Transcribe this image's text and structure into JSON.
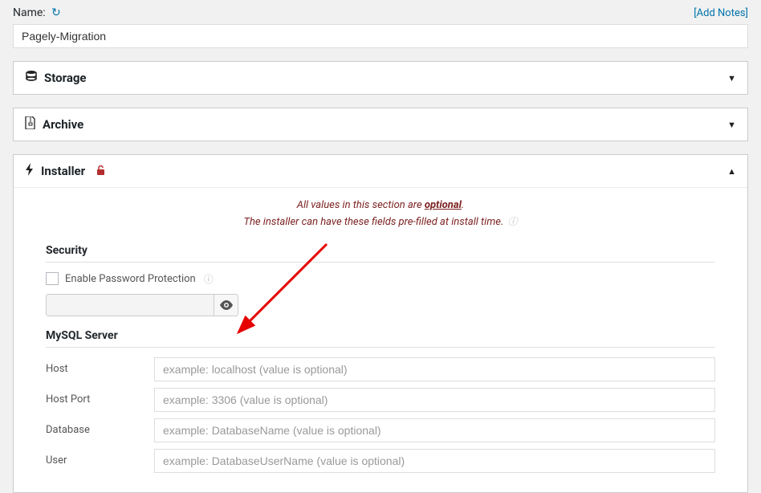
{
  "name_section": {
    "label": "Name:",
    "value": "Pagely-Migration",
    "add_notes": "[Add Notes]"
  },
  "panels": {
    "storage": {
      "title": "Storage"
    },
    "archive": {
      "title": "Archive"
    },
    "installer": {
      "title": "Installer",
      "info_line1_prefix": "All values in this section are ",
      "info_line1_opt": "optional",
      "info_line1_suffix": ".",
      "info_line2": "The installer can have these fields pre-filled at install time."
    }
  },
  "security": {
    "section_label": "Security",
    "checkbox_label": "Enable Password Protection"
  },
  "mysql": {
    "section_label": "MySQL Server",
    "fields": {
      "host": {
        "label": "Host",
        "placeholder": "example: localhost (value is optional)"
      },
      "port": {
        "label": "Host Port",
        "placeholder": "example: 3306 (value is optional)"
      },
      "database": {
        "label": "Database",
        "placeholder": "example: DatabaseName (value is optional)"
      },
      "user": {
        "label": "User",
        "placeholder": "example: DatabaseUserName (value is optional)"
      }
    }
  }
}
